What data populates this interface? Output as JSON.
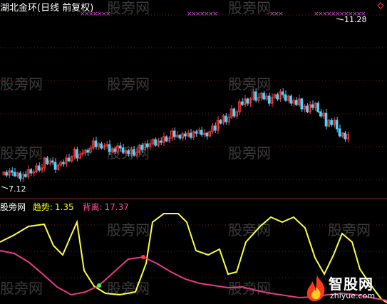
{
  "header": {
    "title": "湖北金环(日线 前复权)"
  },
  "price_panel": {
    "high_label": "11.28",
    "low_label": "7.12",
    "up_color": "#ff3b3b",
    "down_color": "#4ad6ff",
    "marker_color": "#d24bd2"
  },
  "indicator": {
    "name": "股旁网",
    "trend_label": "趋势:",
    "trend_value": "1.35",
    "divergence_label": "背离:",
    "divergence_value": "17.37",
    "trend_color": "#ffff3c",
    "divergence_color": "#e8398a"
  },
  "logo": {
    "text": "智股网",
    "url": "zhiyue.com",
    "icon": "flame-icon"
  },
  "watermarks": [
    "股旁网",
    "股旁网",
    "股旁网",
    "股旁网",
    "股旁网",
    "股旁网",
    "股旁网",
    "股旁网",
    "股旁网",
    "股旁网",
    "股旁网",
    "股旁网",
    "股旁网",
    "股旁网"
  ]
}
